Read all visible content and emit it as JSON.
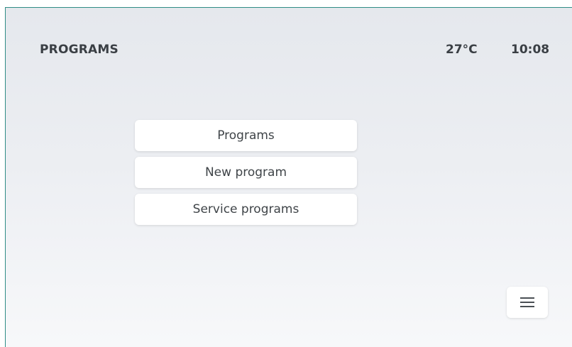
{
  "header": {
    "title": "PROGRAMS",
    "temperature": "27°C",
    "time": "10:08"
  },
  "menu": {
    "items": [
      {
        "label": "Programs"
      },
      {
        "label": "New program"
      },
      {
        "label": "Service programs"
      }
    ]
  },
  "footer": {
    "menu_icon": "hamburger-menu-icon"
  },
  "colors": {
    "background_top": "#e5e8ed",
    "background_bottom": "#f7f8fa",
    "button_background": "#ffffff",
    "text": "#3f4448",
    "frame_border": "#2f8c86"
  }
}
